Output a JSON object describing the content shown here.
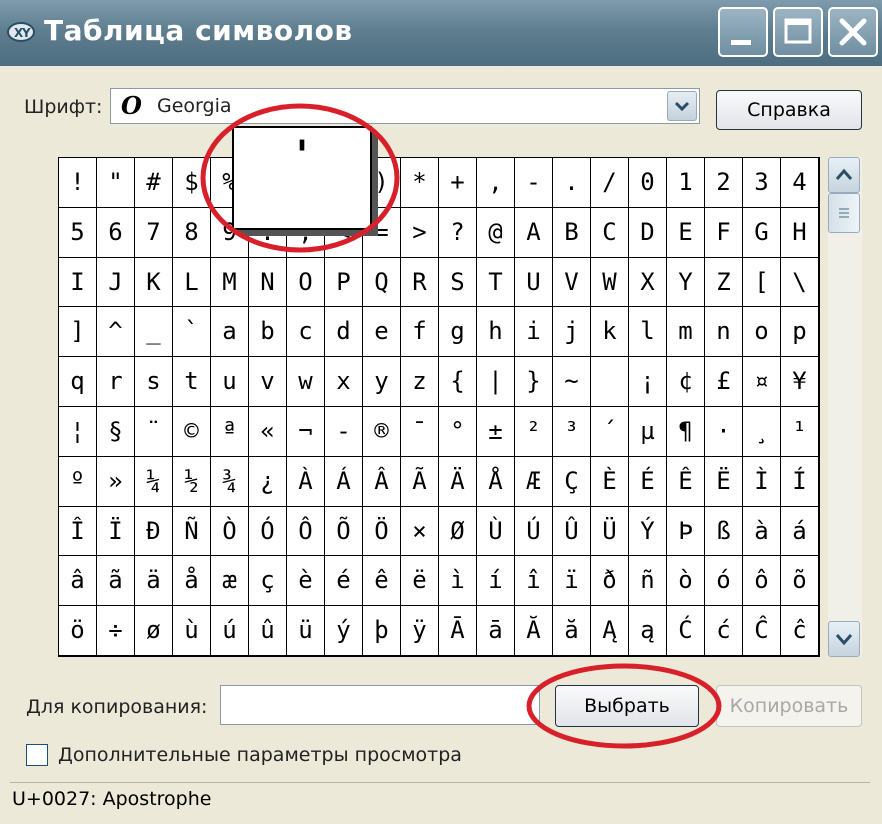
{
  "window": {
    "title": "Таблица символов",
    "title_icon": "charmap-app-icon"
  },
  "titlebar_buttons": {
    "minimize": "minimize-icon",
    "maximize": "maximize-icon",
    "close": "close-icon"
  },
  "font_row": {
    "label": "Шрифт:",
    "selected_font": "Georgia",
    "font_type_glyph": "O",
    "help_button": "Справка"
  },
  "grid": {
    "rows": [
      [
        "!",
        "\"",
        "#",
        "$",
        "%",
        "&",
        "'",
        "(",
        ")",
        "*",
        "+",
        ",",
        "-",
        ".",
        "/",
        "0",
        "1",
        "2",
        "3",
        "4"
      ],
      [
        "5",
        "6",
        "7",
        "8",
        "9",
        ":",
        ";",
        "<",
        "=",
        ">",
        "?",
        "@",
        "A",
        "B",
        "C",
        "D",
        "E",
        "F",
        "G",
        "H"
      ],
      [
        "I",
        "J",
        "K",
        "L",
        "M",
        "N",
        "O",
        "P",
        "Q",
        "R",
        "S",
        "T",
        "U",
        "V",
        "W",
        "X",
        "Y",
        "Z",
        "[",
        "\\"
      ],
      [
        "]",
        "^",
        "_",
        "`",
        "a",
        "b",
        "c",
        "d",
        "e",
        "f",
        "g",
        "h",
        "i",
        "j",
        "k",
        "l",
        "m",
        "n",
        "o",
        "p"
      ],
      [
        "q",
        "r",
        "s",
        "t",
        "u",
        "v",
        "w",
        "x",
        "y",
        "z",
        "{",
        "|",
        "}",
        "~",
        " ",
        "¡",
        "¢",
        "£",
        "¤",
        "¥"
      ],
      [
        "¦",
        "§",
        "¨",
        "©",
        "ª",
        "«",
        "¬",
        "-",
        "®",
        "¯",
        "°",
        "±",
        "²",
        "³",
        "´",
        "µ",
        "¶",
        "·",
        "¸",
        "¹"
      ],
      [
        "º",
        "»",
        "¼",
        "½",
        "¾",
        "¿",
        "À",
        "Á",
        "Â",
        "Ã",
        "Ä",
        "Å",
        "Æ",
        "Ç",
        "È",
        "É",
        "Ê",
        "Ë",
        "Ì",
        "Í"
      ],
      [
        "Î",
        "Ï",
        "Ð",
        "Ñ",
        "Ò",
        "Ó",
        "Ô",
        "Õ",
        "Ö",
        "×",
        "Ø",
        "Ù",
        "Ú",
        "Û",
        "Ü",
        "Ý",
        "Þ",
        "ß",
        "à",
        "á"
      ],
      [
        "â",
        "ã",
        "ä",
        "å",
        "æ",
        "ç",
        "è",
        "é",
        "ê",
        "ë",
        "ì",
        "í",
        "î",
        "ï",
        "ð",
        "ñ",
        "ò",
        "ó",
        "ô",
        "õ"
      ],
      [
        "ö",
        "÷",
        "ø",
        "ù",
        "ú",
        "û",
        "ü",
        "ý",
        "þ",
        "ÿ",
        "Ā",
        "ā",
        "Ă",
        "ă",
        "Ą",
        "ą",
        "Ć",
        "ć",
        "Ĉ",
        "ĉ"
      ]
    ],
    "magnified_char": "'",
    "selected_index": [
      0,
      6
    ]
  },
  "copy_row": {
    "label": "Для копирования:",
    "value": "",
    "select_button": "Выбрать",
    "copy_button": "Копировать"
  },
  "advanced": {
    "label": "Дополнительные параметры просмотра",
    "checked": false
  },
  "status": {
    "text": "U+0027: Apostrophe"
  },
  "colors": {
    "titlebar": "#5f7e90",
    "annotation_circle": "#d8202a",
    "window_bg": "#ece9d8"
  }
}
